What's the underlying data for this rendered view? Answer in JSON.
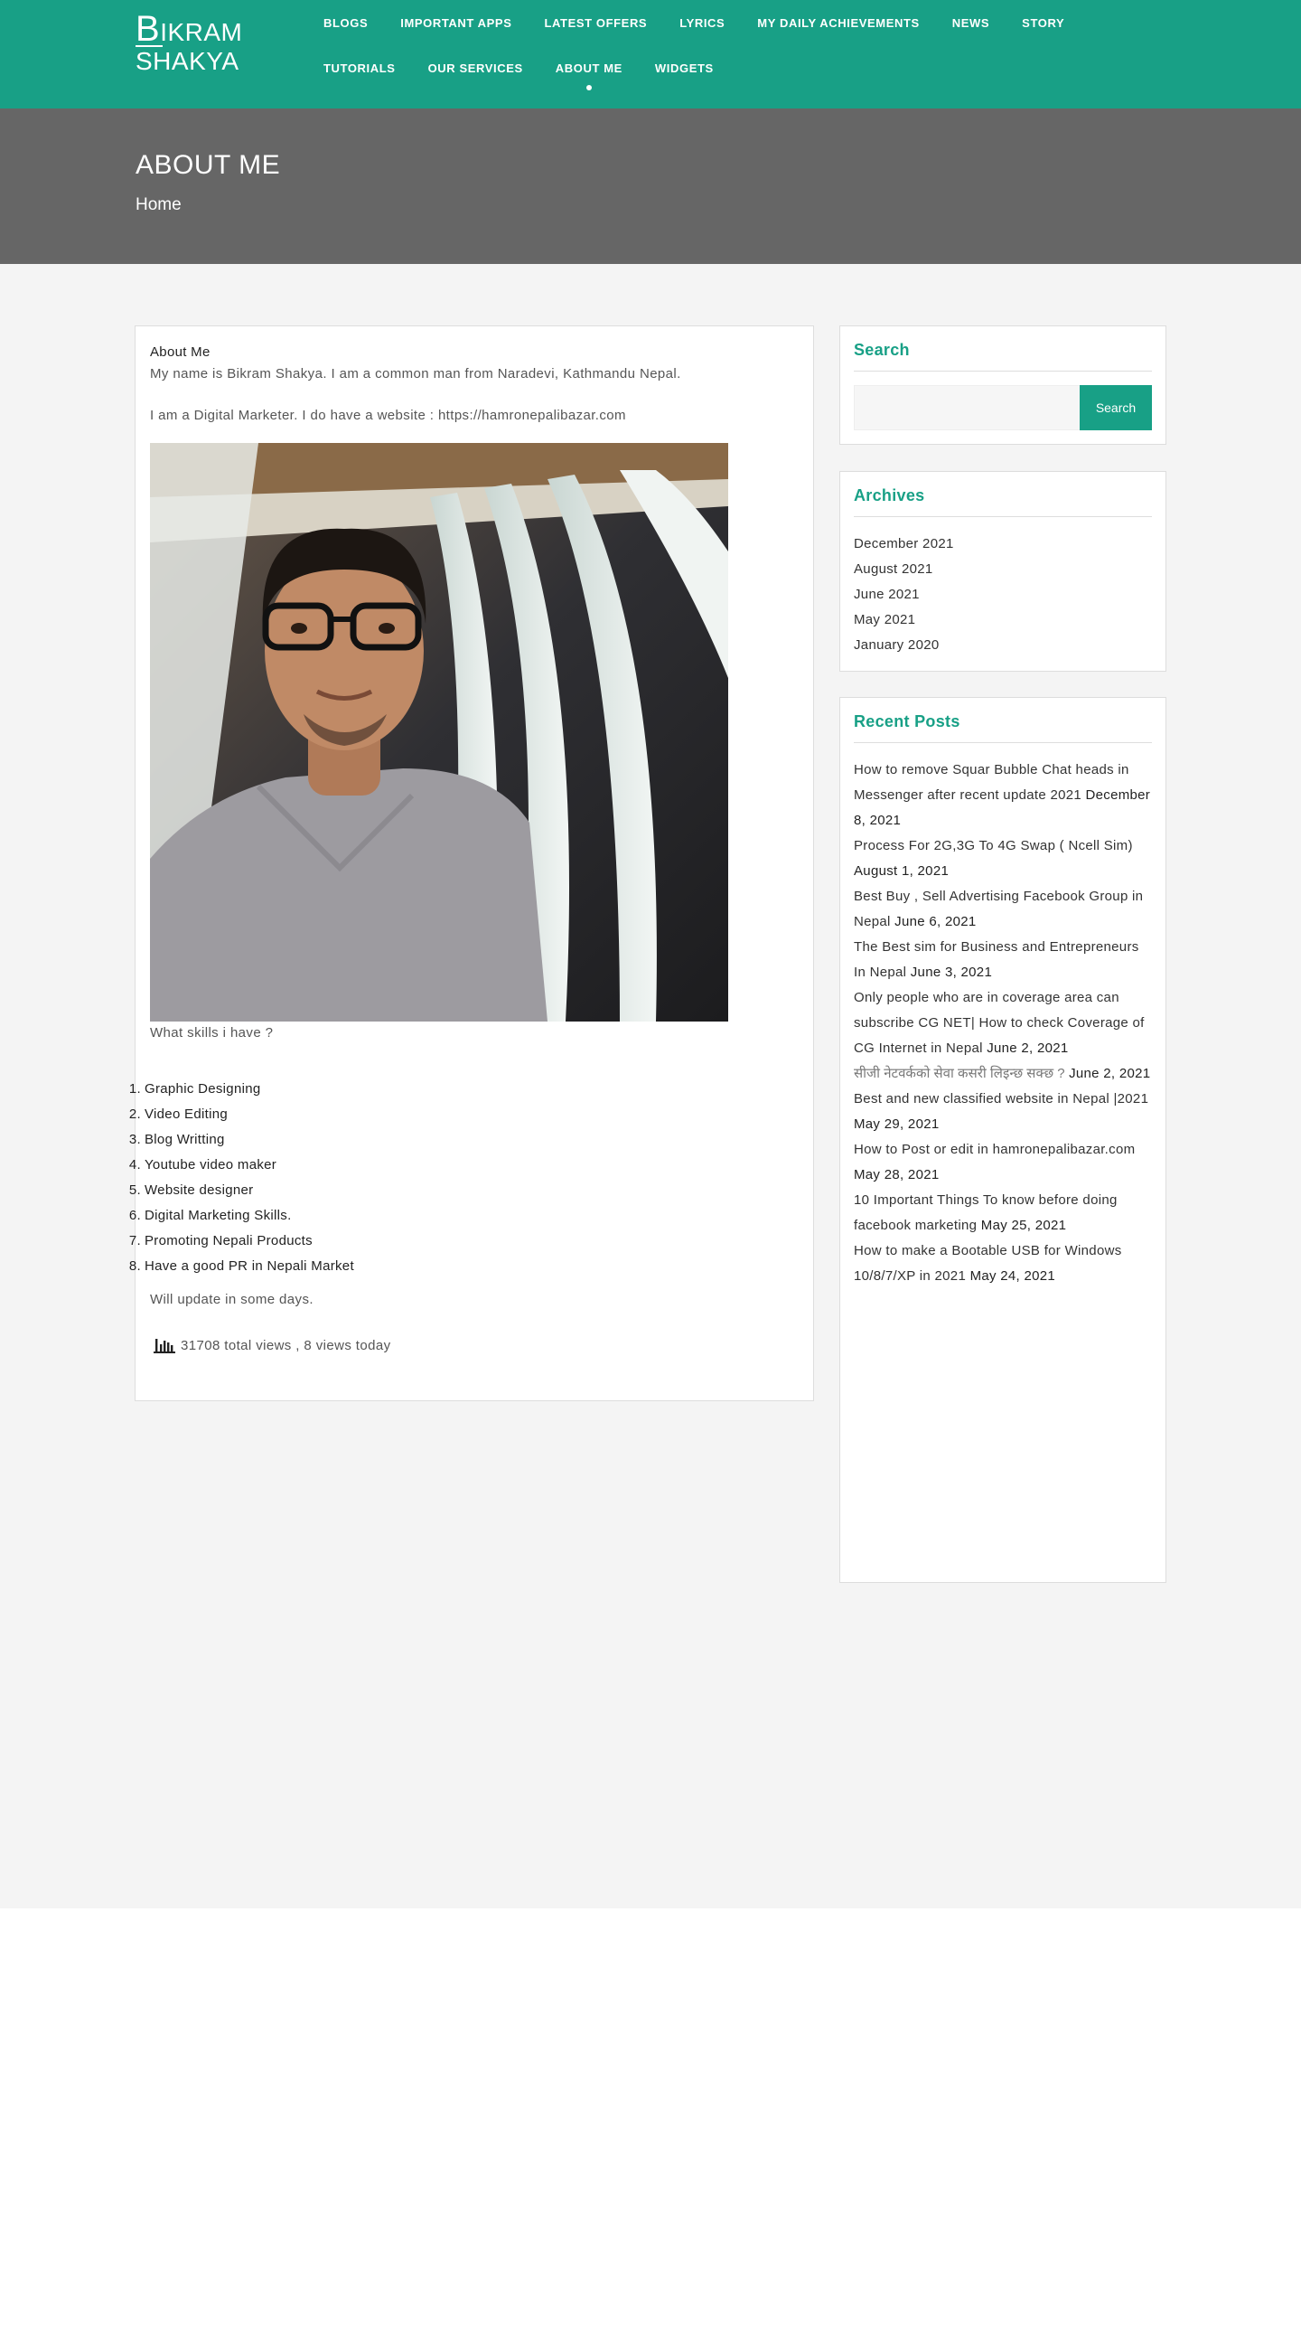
{
  "site": {
    "logo_line1_cap": "B",
    "logo_line1_rest": "IKRAM",
    "logo_line2": "SHAKYA"
  },
  "nav": {
    "row1": [
      "BLOGS",
      "IMPORTANT APPS",
      "LATEST OFFERS",
      "LYRICS",
      "MY DAILY ACHIEVEMENTS",
      "NEWS",
      "STORY"
    ],
    "row2": [
      "TUTORIALS",
      "OUR SERVICES",
      "ABOUT ME",
      "WIDGETS"
    ],
    "active": "ABOUT ME"
  },
  "banner": {
    "title": "ABOUT ME",
    "breadcrumb": "Home"
  },
  "article": {
    "heading": "About Me",
    "para1": "My name is Bikram Shakya. I am a common man from Naradevi, Kathmandu Nepal.",
    "para2": "I am a Digital Marketer. I do have a website : https://hamronepalibazar.com",
    "skills_title": "What skills i have ?",
    "skills": [
      "Graphic Designing",
      "Video Editing",
      "Blog Writting",
      "Youtube video maker",
      "Website designer",
      "Digital Marketing Skills.",
      "Promoting Nepali Products",
      "Have a good PR in Nepali Market"
    ],
    "update_note": "Will update in some days.",
    "views": "31708 total views , 8 views today"
  },
  "sidebar": {
    "search": {
      "title": "Search",
      "placeholder": "",
      "button": "Search"
    },
    "archives": {
      "title": "Archives",
      "items": [
        "December 2021",
        "August 2021",
        "June 2021",
        "May 2021",
        "January 2020"
      ]
    },
    "recent": {
      "title": "Recent Posts",
      "posts": [
        {
          "title": "How to remove Squar Bubble Chat heads in Messenger after recent update 2021",
          "date": "December 8, 2021"
        },
        {
          "title": "Process For 2G,3G To 4G Swap ( Ncell Sim)",
          "date": "August 1, 2021"
        },
        {
          "title": "Best Buy , Sell Advertising Facebook Group in Nepal",
          "date": "June 6, 2021"
        },
        {
          "title": "The Best sim for Business and Entrepreneurs In Nepal",
          "date": "June 3, 2021"
        },
        {
          "title": "Only people who are in coverage area can subscribe CG NET| How to check Coverage of CG Internet in Nepal",
          "date": "June 2, 2021"
        },
        {
          "title": "सीजी नेटवर्कको सेवा कसरी लिइन्छ सक्छ ?",
          "date": "June 2, 2021",
          "devanagari": true
        },
        {
          "title": "Best and new classified website in Nepal |2021",
          "date": "May 29, 2021"
        },
        {
          "title": "How to Post or edit in hamronepalibazar.com",
          "date": "May 28, 2021"
        },
        {
          "title": "10 Important Things To know before doing facebook marketing",
          "date": "May 25, 2021"
        },
        {
          "title": "How to make a Bootable USB for Windows 10/8/7/XP in 2021",
          "date": "May 24, 2021"
        }
      ]
    }
  },
  "colors": {
    "brand": "#18a086",
    "banner": "#666666",
    "content_bg": "#f4f4f4"
  }
}
